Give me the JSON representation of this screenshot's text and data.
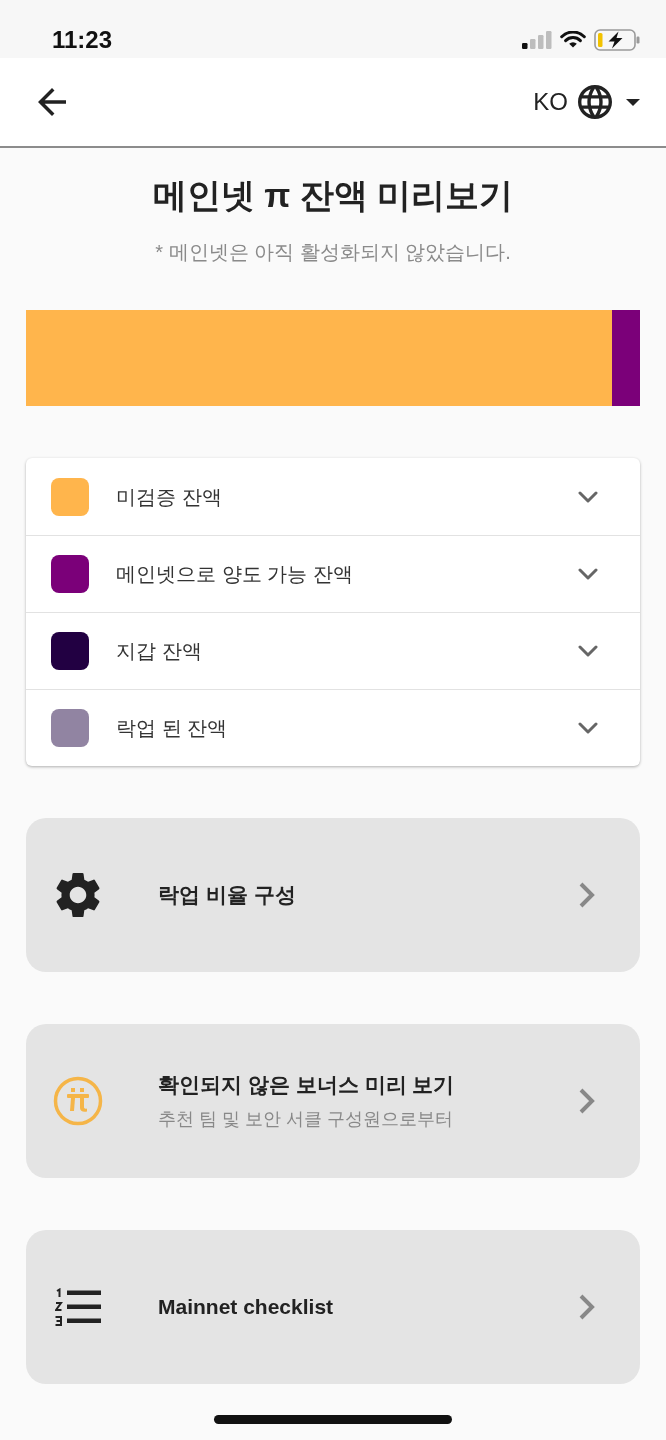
{
  "status_bar": {
    "time": "11:23"
  },
  "header": {
    "language": "KO"
  },
  "title": "메인넷 π 잔액 미리보기",
  "subtitle": "* 메인넷은 아직 활성화되지 않았습니다.",
  "balance_bar": {
    "segments": [
      {
        "color": "#ffb54c",
        "level": 0.954
      },
      {
        "color": "#7b0079",
        "level": 0.046
      }
    ]
  },
  "balances": [
    {
      "label": "미검증 잔액",
      "color": "#ffb54c",
      "expanded": false
    },
    {
      "label": "메인넷으로 양도 가능 잔액",
      "color": "#7b0079",
      "expanded": false
    },
    {
      "label": "지갑 잔액",
      "color": "#220042",
      "expanded": false
    },
    {
      "label": "락업 된 잔액",
      "color": "#9184a2",
      "expanded": false
    }
  ],
  "actions": [
    {
      "kind": "settings",
      "title": "락업 비율 구성"
    },
    {
      "kind": "coin",
      "title": "확인되지 않은 보너스 미리 보기",
      "subtitle": "추천 팀 및 보안 서클 구성원으로부터"
    },
    {
      "kind": "checklist",
      "title": "Mainnet checklist"
    }
  ]
}
